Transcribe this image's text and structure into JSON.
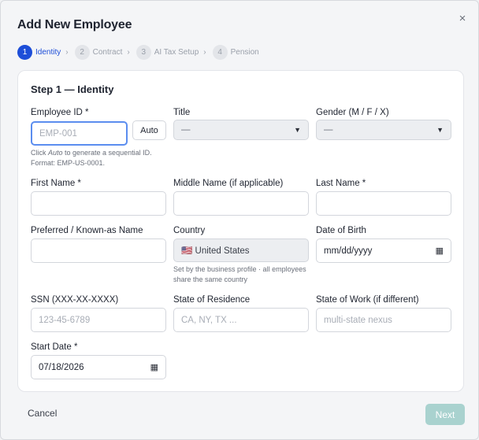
{
  "modal": {
    "title": "Add New Employee",
    "close_glyph": "×",
    "accent_color": "#1d4ed8"
  },
  "stepper": [
    {
      "num": "1",
      "label": "Identity",
      "active": true
    },
    {
      "num": "2",
      "label": "Contract",
      "active": false
    },
    {
      "num": "3",
      "label": "AI Tax Setup",
      "active": false
    },
    {
      "num": "4",
      "label": "Pension",
      "active": false
    }
  ],
  "card": {
    "title": "Step 1 — Identity"
  },
  "fields": {
    "employee_id": {
      "label": "Employee ID *",
      "placeholder": "EMP-001",
      "auto_label": "Auto",
      "hint_pre": "Click ",
      "hint_em": "Auto",
      "hint_post": " to generate a sequential ID.",
      "hint_line2": "Format: EMP-US-0001."
    },
    "title": {
      "label": "Title",
      "value": "—"
    },
    "gender": {
      "label": "Gender (M / F / X)",
      "value": "—"
    },
    "first_name": {
      "label": "First Name *",
      "value": ""
    },
    "middle_name": {
      "label": "Middle Name (if applicable)",
      "value": ""
    },
    "last_name": {
      "label": "Last Name *",
      "value": ""
    },
    "preferred_name": {
      "label": "Preferred / Known-as Name",
      "value": ""
    },
    "country": {
      "label": "Country",
      "value": "🇺🇸 United States",
      "hint": "Set by the business profile · all employees share the same country"
    },
    "date_of_birth": {
      "label": "Date of Birth",
      "value": "mm/dd/yyyy"
    },
    "ssn": {
      "label": "SSN (XXX-XX-XXXX)",
      "placeholder": "123-45-6789"
    },
    "state_of_residence": {
      "label": "State of Residence",
      "placeholder": "CA, NY, TX ..."
    },
    "state_of_work": {
      "label": "State of Work (if different)",
      "placeholder": "multi-state nexus"
    },
    "start_date": {
      "label": "Start Date *",
      "value": "07/18/2026"
    }
  },
  "footer": {
    "cancel_label": "Cancel",
    "next_label": "Next"
  }
}
